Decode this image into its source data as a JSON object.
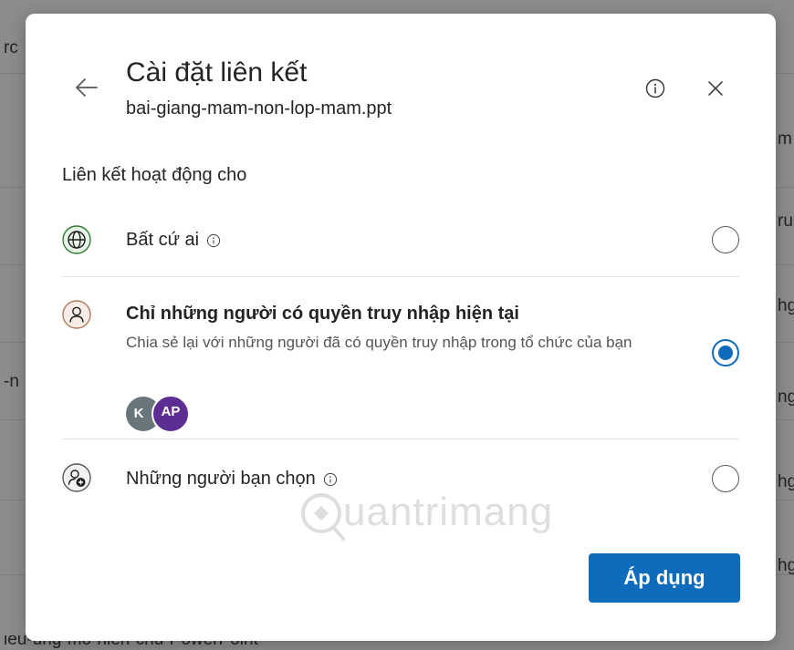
{
  "background": {
    "fragments": [
      "rc",
      "m",
      "ru",
      "hg",
      "-n",
      "ng",
      "hg",
      "hg"
    ],
    "bottom_text": "ieu-ung-mo-nien-cnu-PowerPoint"
  },
  "dialog": {
    "title": "Cài đặt liên kết",
    "file_name": "bai-giang-mam-non-lop-mam.ppt",
    "section_label": "Liên kết hoạt động cho",
    "options": [
      {
        "label": "Bất cứ ai",
        "has_info": true,
        "selected": false
      },
      {
        "label": "Chỉ những người có quyền truy nhập hiện tại",
        "description": "Chia sẻ lại với những người đã có quyền truy nhập trong tổ chức của bạn",
        "selected": true,
        "avatars": [
          {
            "initials": "K",
            "color": "#68767c"
          },
          {
            "initials": "AP",
            "color": "#5c2e91"
          }
        ]
      },
      {
        "label": "Những người bạn chọn",
        "has_info": true,
        "selected": false
      }
    ],
    "apply_label": "Áp dụng"
  },
  "watermark": "uantrimang",
  "colors": {
    "accent": "#0f6cbd",
    "globe_icon": "#2e7d32",
    "person_icon": "#b07a5e"
  },
  "icons": {
    "back": "arrow-left-icon",
    "info": "info-icon",
    "close": "close-icon",
    "globe": "globe-icon",
    "person": "person-icon",
    "person_add": "person-add-icon"
  }
}
